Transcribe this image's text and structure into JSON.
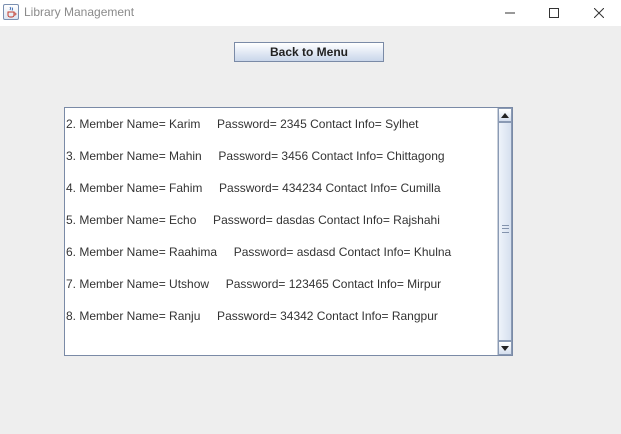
{
  "window": {
    "title": "Library Management",
    "icon": "java-cup-icon",
    "controls": [
      "minimize-icon",
      "maximize-icon",
      "close-icon"
    ]
  },
  "toolbar": {
    "back_label": "Back to Menu"
  },
  "members": [
    {
      "text": "2. Member Name= Karim     Password= 2345 Contact Info= Sylhet"
    },
    {
      "text": "3. Member Name= Mahin     Password= 3456 Contact Info= Chittagong"
    },
    {
      "text": "4. Member Name= Fahim     Password= 434234 Contact Info= Cumilla"
    },
    {
      "text": "5. Member Name= Echo     Password= dasdas Contact Info= Rajshahi"
    },
    {
      "text": "6. Member Name= Raahima     Password= asdasd Contact Info= Khulna"
    },
    {
      "text": "7. Member Name= Utshow     Password= 123465 Contact Info= Mirpur"
    },
    {
      "text": "8. Member Name= Ranju     Password= 34342 Contact Info= Rangpur"
    }
  ]
}
